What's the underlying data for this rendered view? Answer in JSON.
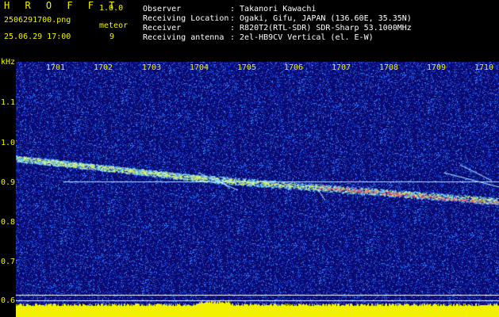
{
  "app": {
    "title": "H R O F F T",
    "version": "1.0.0"
  },
  "file": {
    "name": "2506291700.png",
    "datetime": "25.06.29 17:00"
  },
  "meteor": {
    "label": "meteor",
    "count": "9"
  },
  "info": {
    "observer_label": "Observer",
    "observer": ": Takanori Kawachi",
    "location_label": "Receiving Location",
    "location": ": Ogaki, Gifu, JAPAN (136.60E, 35.35N)",
    "receiver_label": "Receiver",
    "receiver": ": R820T2(RTL-SDR) SDR-Sharp 53.1000MHz",
    "antenna_label": "Receiving antenna",
    "antenna": ": 2el-HB9CV Vertical (el. E-W)"
  },
  "axis": {
    "y_unit": "kHz",
    "x_ticks": [
      "1701",
      "1702",
      "1703",
      "1704",
      "1705",
      "1706",
      "1707",
      "1708",
      "1709",
      "1710"
    ],
    "y_ticks": [
      "1.1",
      "1.0",
      "0.9",
      "0.8",
      "0.7",
      "0.6"
    ]
  },
  "colors": {
    "background": "#0a0a6e",
    "noise": "#3050ff",
    "label": "#f2f200",
    "carrier": "#9ff0ff",
    "meteor": "#f0ff60"
  }
}
